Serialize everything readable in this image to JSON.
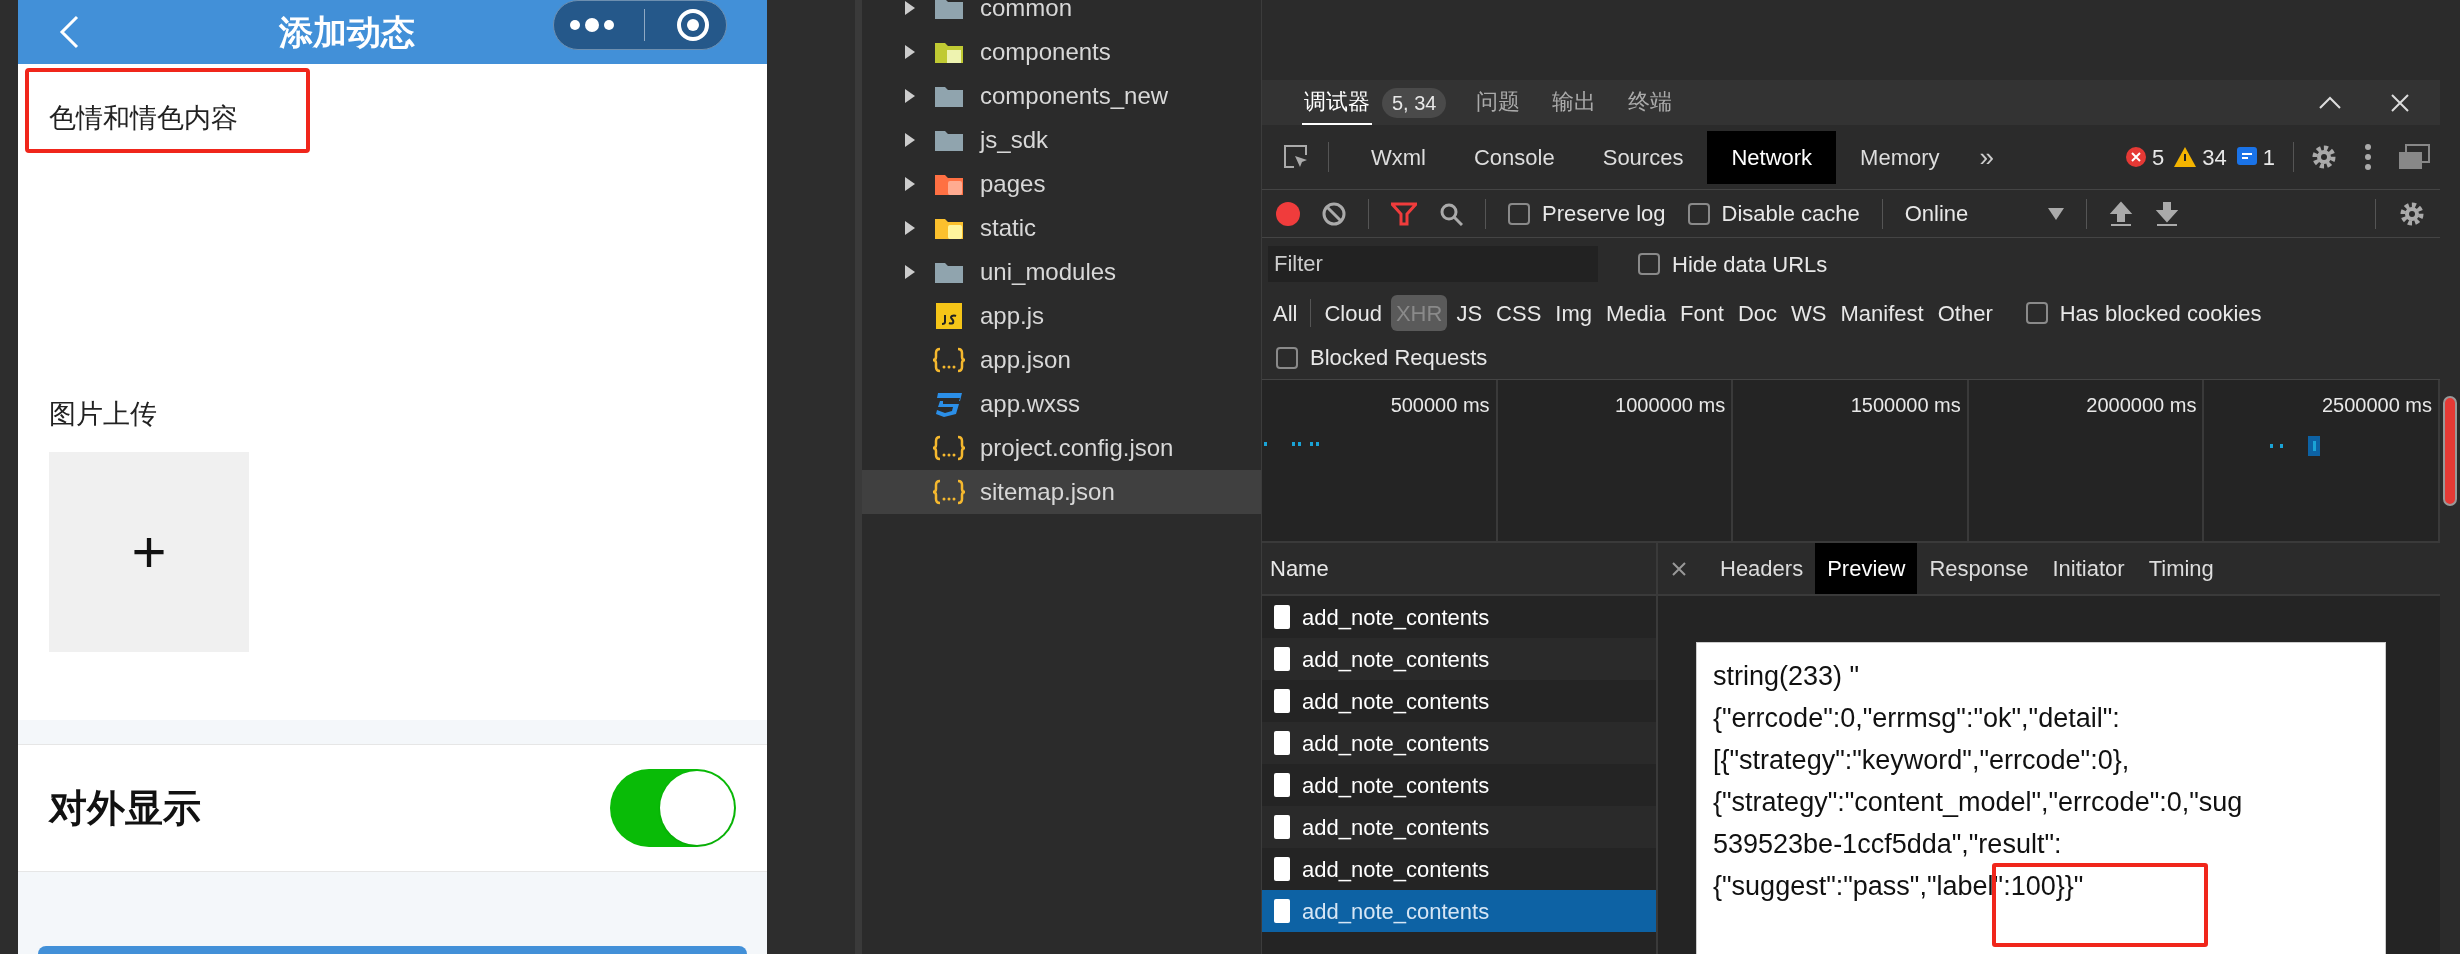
{
  "phone": {
    "title": "添加动态",
    "content_text": "色情和情色内容",
    "upload_label": "图片上传",
    "upload_plus": "+",
    "visibility_label": "对外显示",
    "visibility_on": true
  },
  "file_tree": {
    "items": [
      {
        "name": "common",
        "kind": "folder",
        "selected": false
      },
      {
        "name": "components",
        "kind": "components-folder",
        "selected": false
      },
      {
        "name": "components_new",
        "kind": "folder",
        "selected": false
      },
      {
        "name": "js_sdk",
        "kind": "folder",
        "selected": false
      },
      {
        "name": "pages",
        "kind": "pages-folder",
        "selected": false
      },
      {
        "name": "static",
        "kind": "static-folder",
        "selected": false
      },
      {
        "name": "uni_modules",
        "kind": "folder",
        "selected": false
      },
      {
        "name": "app.js",
        "kind": "js",
        "selected": false
      },
      {
        "name": "app.json",
        "kind": "json",
        "selected": false
      },
      {
        "name": "app.wxss",
        "kind": "css",
        "selected": false
      },
      {
        "name": "project.config.json",
        "kind": "json",
        "selected": false
      },
      {
        "name": "sitemap.json",
        "kind": "json",
        "selected": true
      }
    ]
  },
  "devtools": {
    "panel_tabs": [
      {
        "label": "调试器",
        "badge": "5, 34",
        "selected": true
      },
      {
        "label": "问题",
        "selected": false
      },
      {
        "label": "输出",
        "selected": false
      },
      {
        "label": "终端",
        "selected": false
      }
    ],
    "tool_tabs": [
      {
        "label": "Wxml",
        "selected": false
      },
      {
        "label": "Console",
        "selected": false
      },
      {
        "label": "Sources",
        "selected": false
      },
      {
        "label": "Network",
        "selected": true
      },
      {
        "label": "Memory",
        "selected": false
      }
    ],
    "more": "»",
    "errors": "5",
    "warnings": "34",
    "infos": "1",
    "toolbar_checks": [
      {
        "label": "Preserve log",
        "checked": false
      },
      {
        "label": "Disable cache",
        "checked": false
      }
    ],
    "throttle": "Online",
    "filter": {
      "placeholder": "Filter"
    },
    "hide_data_urls": {
      "label": "Hide data URLs",
      "checked": false
    },
    "type_filters": [
      {
        "label": "All",
        "selected": false
      },
      {
        "label": "Cloud",
        "selected": false
      },
      {
        "label": "XHR",
        "selected": true
      },
      {
        "label": "JS",
        "selected": false
      },
      {
        "label": "CSS",
        "selected": false
      },
      {
        "label": "Img",
        "selected": false
      },
      {
        "label": "Media",
        "selected": false
      },
      {
        "label": "Font",
        "selected": false
      },
      {
        "label": "Doc",
        "selected": false
      },
      {
        "label": "WS",
        "selected": false
      },
      {
        "label": "Manifest",
        "selected": false
      },
      {
        "label": "Other",
        "selected": false
      }
    ],
    "has_blocked_cookies": {
      "label": "Has blocked cookies",
      "checked": false
    },
    "blocked_requests": {
      "label": "Blocked Requests",
      "checked": false
    },
    "timeline_ticks": [
      "500000 ms",
      "1000000 ms",
      "1500000 ms",
      "2000000 ms",
      "2500000 ms"
    ],
    "requests": {
      "header": "Name",
      "rows": [
        {
          "name": "add_note_contents",
          "selected": false
        },
        {
          "name": "add_note_contents",
          "selected": false
        },
        {
          "name": "add_note_contents",
          "selected": false
        },
        {
          "name": "add_note_contents",
          "selected": false
        },
        {
          "name": "add_note_contents",
          "selected": false
        },
        {
          "name": "add_note_contents",
          "selected": false
        },
        {
          "name": "add_note_contents",
          "selected": false
        },
        {
          "name": "add_note_contents",
          "selected": true
        }
      ]
    },
    "detail_tabs": [
      {
        "label": "Headers",
        "selected": false
      },
      {
        "label": "Preview",
        "selected": true
      },
      {
        "label": "Response",
        "selected": false
      },
      {
        "label": "Initiator",
        "selected": false
      },
      {
        "label": "Timing",
        "selected": false
      }
    ],
    "preview_lines": [
      "string(233) \"",
      "{\"errcode\":0,\"errmsg\":\"ok\",\"detail\":",
      "[{\"strategy\":\"keyword\",\"errcode\":0},",
      "{\"strategy\":\"content_model\",\"errcode\":0,\"sug",
      "539523be-1ccf5dda\",\"result\":",
      "{\"suggest\":\"pass\",\"label\":100}}\""
    ]
  }
}
